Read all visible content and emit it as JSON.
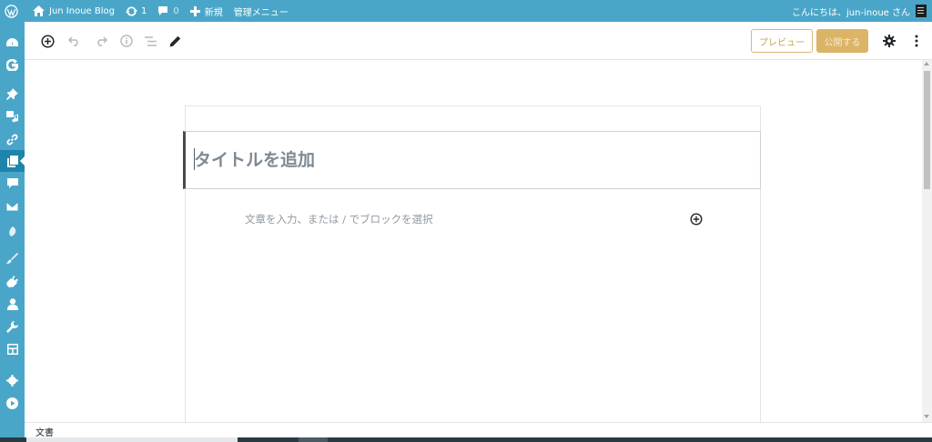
{
  "admin_bar": {
    "site_name": "Jun Inoue Blog",
    "updates_count": "1",
    "comments_count": "0",
    "new_label": "新規",
    "admin_menu_label": "管理メニュー",
    "greeting": "こんにちは、jun-inoue さん"
  },
  "sidebar": {
    "items": [
      {
        "icon": "dashboard-icon"
      },
      {
        "icon": "google-icon"
      },
      {
        "icon": "pin-icon"
      },
      {
        "icon": "media-icon"
      },
      {
        "icon": "link-icon"
      },
      {
        "icon": "pages-icon",
        "active": true
      },
      {
        "icon": "comment-icon"
      },
      {
        "icon": "mail-icon"
      },
      {
        "icon": "leaf-icon"
      },
      {
        "icon": "brush-icon"
      },
      {
        "icon": "plugin-icon"
      },
      {
        "icon": "user-icon"
      },
      {
        "icon": "wrench-icon"
      },
      {
        "icon": "settings-grid-icon"
      },
      {
        "icon": "gear-icon"
      },
      {
        "icon": "play-icon"
      }
    ]
  },
  "toolbar": {
    "preview_label": "プレビュー",
    "publish_label": "公開する"
  },
  "editor": {
    "title_placeholder": "タイトルを追加",
    "paragraph_placeholder": "文章を入力、または / でブロックを選択"
  },
  "footer": {
    "breadcrumb": "文書"
  },
  "colors": {
    "admin_bar_bg": "#4aa6c9",
    "sidebar_active": "#1f84ab",
    "publish_bg": "#dbb466",
    "preview_border": "#d8b77a"
  }
}
